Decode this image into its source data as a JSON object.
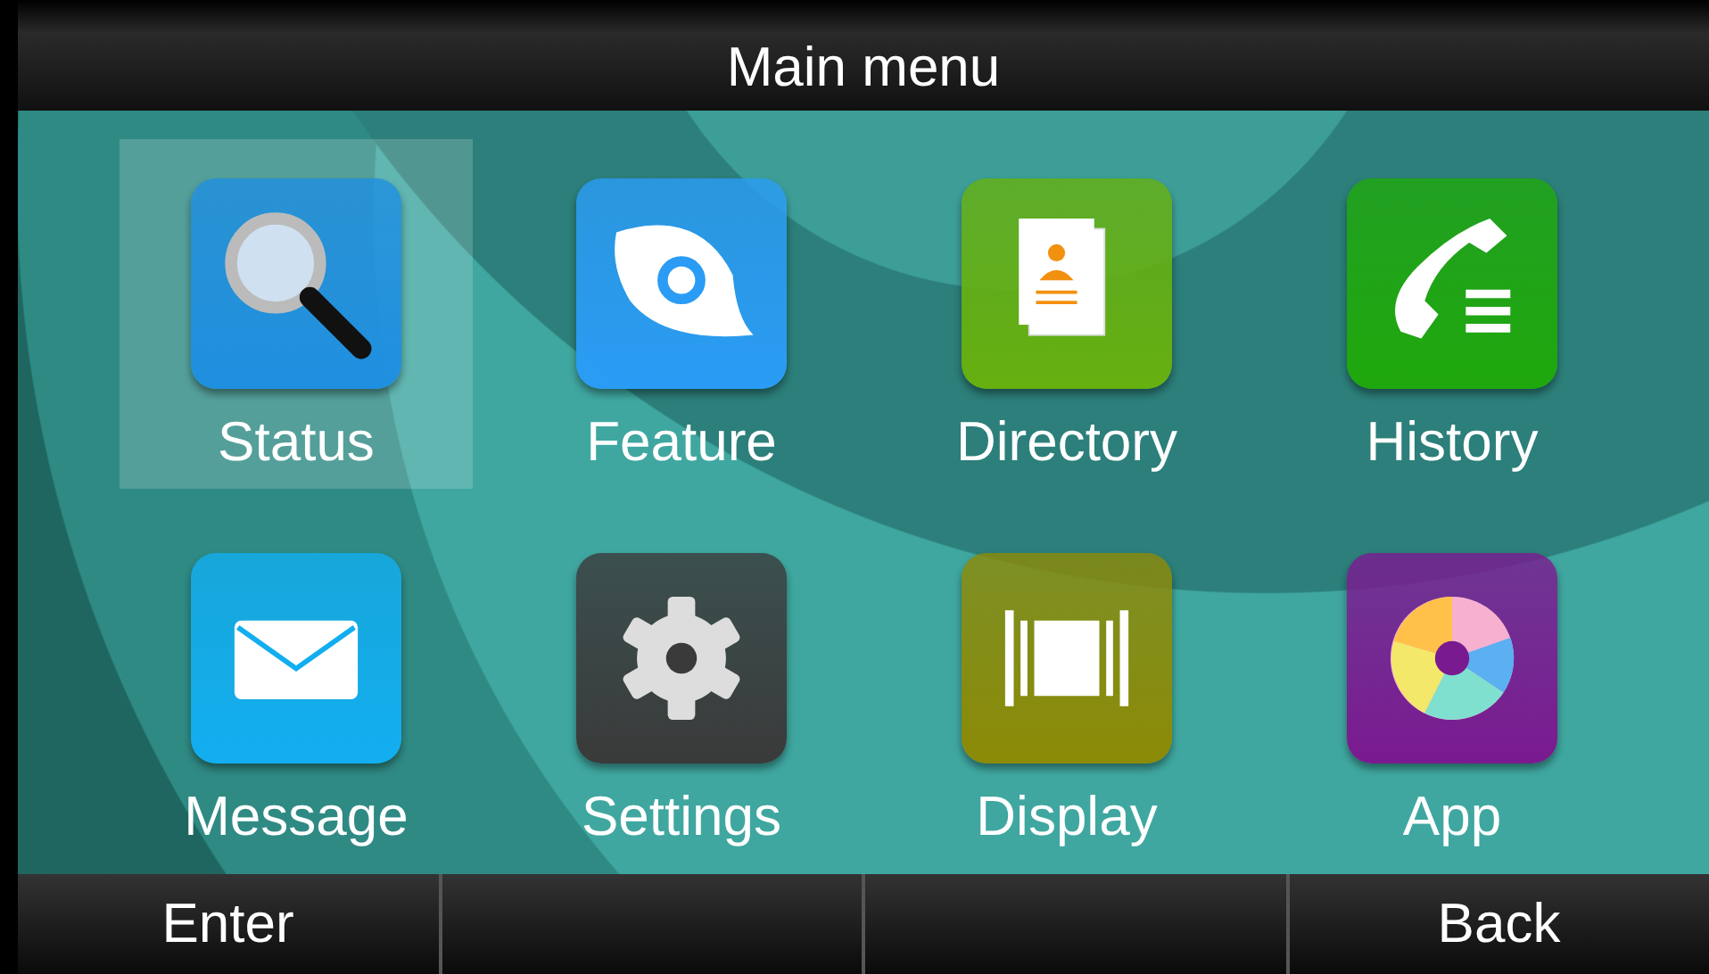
{
  "title": "Main menu",
  "items": [
    {
      "label": "Status",
      "kind": "search",
      "color": "#1f8fe0",
      "selected": true
    },
    {
      "label": "Feature",
      "kind": "feature",
      "color": "#2a9cf5",
      "selected": false
    },
    {
      "label": "Directory",
      "kind": "directory",
      "color": "#66b010",
      "selected": false
    },
    {
      "label": "History",
      "kind": "history",
      "color": "#1fa80c",
      "selected": false
    },
    {
      "label": "Message",
      "kind": "message",
      "color": "#12aef0",
      "selected": false
    },
    {
      "label": "Settings",
      "kind": "settings",
      "color": "#3a3a3a",
      "selected": false
    },
    {
      "label": "Display",
      "kind": "display",
      "color": "#8c8a06",
      "selected": false
    },
    {
      "label": "App",
      "kind": "app",
      "color": "#7a1a90",
      "selected": false
    }
  ],
  "softkeys": {
    "left": "Enter",
    "right": "Back"
  }
}
